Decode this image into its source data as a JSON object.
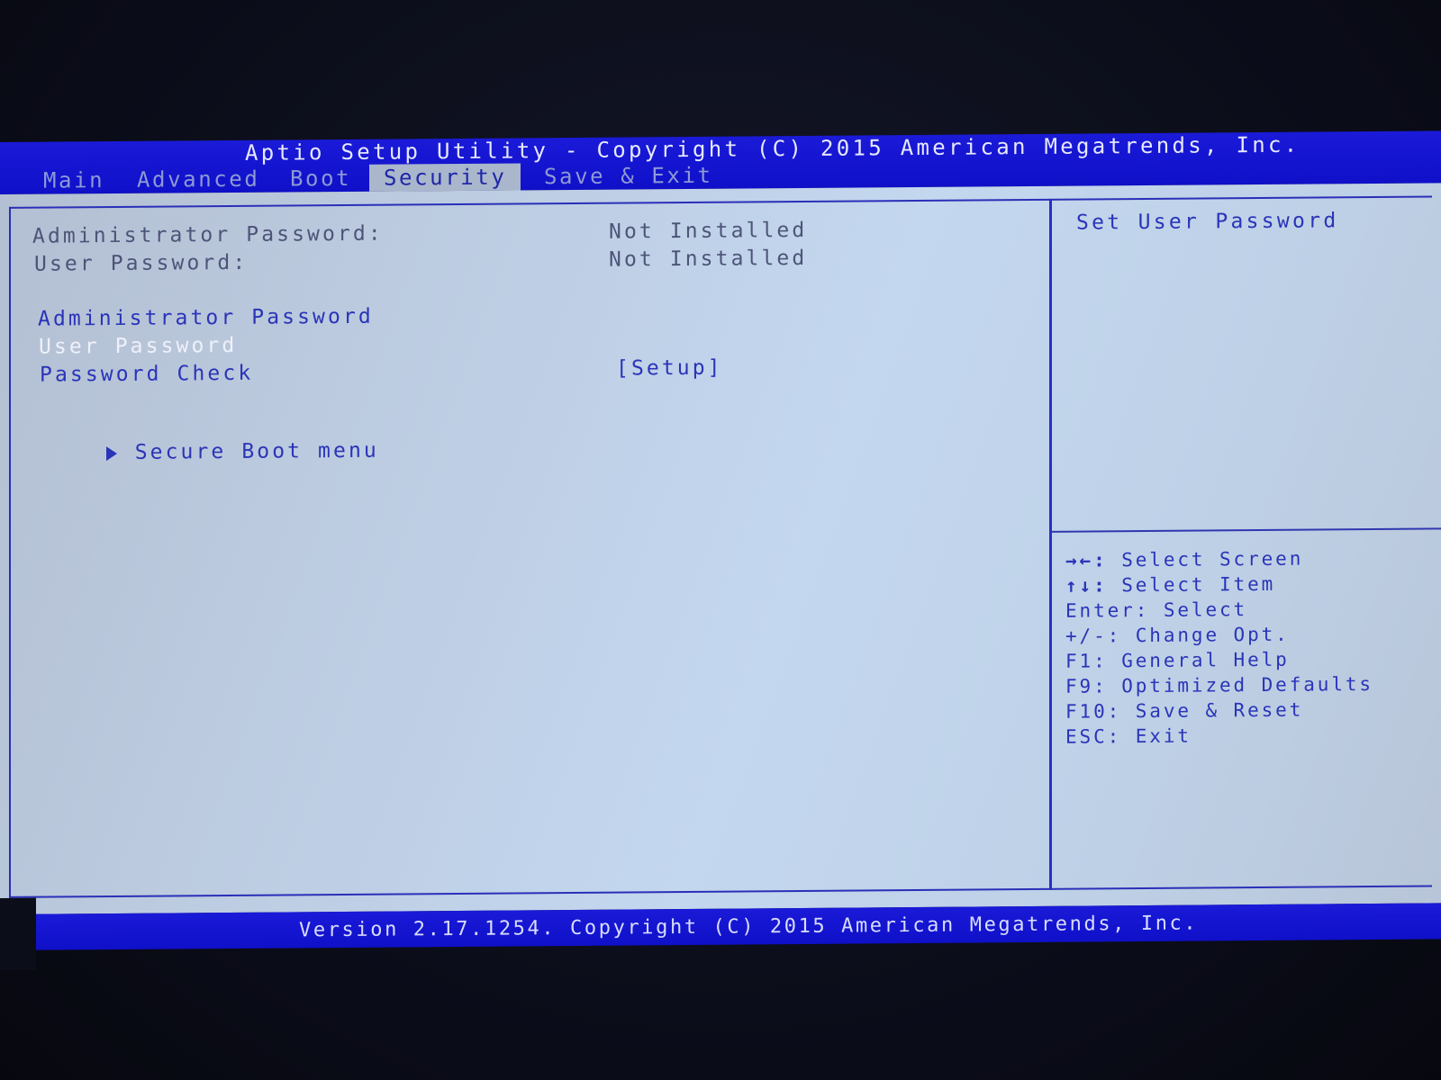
{
  "header": {
    "title": "Aptio Setup Utility - Copyright (C) 2015 American Megatrends, Inc."
  },
  "tabs": [
    {
      "label": "Main",
      "active": false
    },
    {
      "label": "Advanced",
      "active": false
    },
    {
      "label": "Boot",
      "active": false
    },
    {
      "label": "Security",
      "active": true
    },
    {
      "label": "Save & Exit",
      "active": false
    }
  ],
  "main": {
    "status": [
      {
        "label": "Administrator Password:",
        "value": "Not Installed"
      },
      {
        "label": "User Password:",
        "value": "Not Installed"
      }
    ],
    "items": [
      {
        "label": "Administrator Password",
        "value": "",
        "selected": false
      },
      {
        "label": "User Password",
        "value": "",
        "selected": true
      },
      {
        "label": "Password Check",
        "value": "[Setup]",
        "selected": false
      }
    ],
    "submenu": {
      "label": "Secure Boot menu",
      "icon": "triangle-right-icon"
    }
  },
  "help": {
    "description": "Set User Password",
    "keys": [
      {
        "key": "→←:",
        "action": "Select Screen"
      },
      {
        "key": "↑↓:",
        "action": "Select Item"
      },
      {
        "key": "Enter:",
        "action": "Select"
      },
      {
        "key": "+/-:",
        "action": "Change Opt."
      },
      {
        "key": "F1:",
        "action": "General Help"
      },
      {
        "key": "F9:",
        "action": "Optimized Defaults"
      },
      {
        "key": "F10:",
        "action": "Save & Reset"
      },
      {
        "key": "ESC:",
        "action": "Exit"
      }
    ]
  },
  "footer": {
    "text": "Version 2.17.1254. Copyright (C) 2015 American Megatrends, Inc."
  },
  "colors": {
    "title_bar": "#1414d0",
    "panel_bg": "#c3d7ef",
    "item_text": "#2a34b8",
    "static_text": "#4d5478",
    "selected_text": "#eef1fa",
    "active_tab_bg": "#a9b6cc",
    "inactive_tab_text": "#8e99d4"
  }
}
